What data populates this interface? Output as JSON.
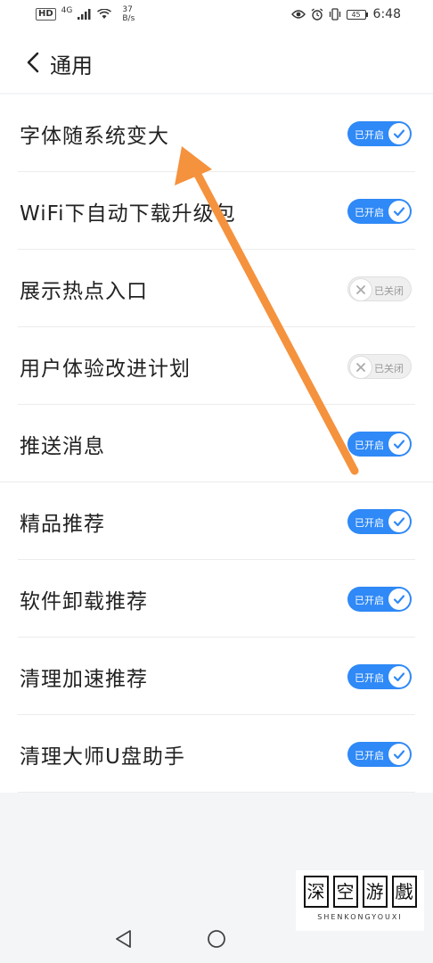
{
  "status_bar": {
    "hd": "HD",
    "net_type": "4G",
    "speed_value": "37",
    "speed_unit": "B/s",
    "battery": "45",
    "time": "6:48"
  },
  "header": {
    "title": "通用"
  },
  "settings": [
    {
      "label": "字体随系统变大",
      "state": "on",
      "status": "已开启"
    },
    {
      "label": "WiFi下自动下载升级包",
      "state": "on",
      "status": "已开启"
    },
    {
      "label": "展示热点入口",
      "state": "off",
      "status": "已关闭"
    },
    {
      "label": "用户体验改进计划",
      "state": "off",
      "status": "已关闭"
    },
    {
      "label": "推送消息",
      "state": "on",
      "status": "已开启"
    },
    {
      "label": "精品推荐",
      "state": "on",
      "status": "已开启"
    },
    {
      "label": "软件卸载推荐",
      "state": "on",
      "status": "已开启"
    },
    {
      "label": "清理加速推荐",
      "state": "on",
      "status": "已开启"
    },
    {
      "label": "清理大师U盘助手",
      "state": "on",
      "status": "已开启"
    }
  ],
  "watermark": {
    "chars": [
      "深",
      "空",
      "游",
      "戲"
    ],
    "text": "SHENKONGYOUXI"
  },
  "colors": {
    "accent": "#2f89f6",
    "annotation_arrow": "#f5923e"
  }
}
